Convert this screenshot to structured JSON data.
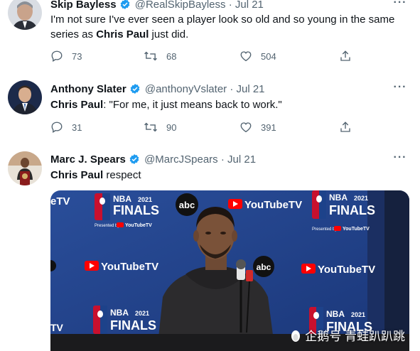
{
  "tweets": [
    {
      "name": "Skip Bayless",
      "handle": "@RealSkipBayless",
      "dot": "·",
      "date": "Jul 21",
      "text_pre": "I'm not sure I've ever seen a player look so old and so young in the same series as ",
      "text_bold": "Chris Paul",
      "text_post": " just did.",
      "replies": "73",
      "retweets": "68",
      "likes": "504"
    },
    {
      "name": "Anthony Slater",
      "handle": "@anthonyVslater",
      "dot": "·",
      "date": "Jul 21",
      "text_bold": "Chris Paul",
      "text_post": ": \"For me, it just means back to work.\"",
      "replies": "31",
      "retweets": "90",
      "likes": "391"
    },
    {
      "name": "Marc J. Spears",
      "handle": "@MarcJSpears",
      "dot": "·",
      "date": "Jul 21",
      "text_bold": "Chris Paul",
      "text_post": " respect"
    }
  ],
  "backdrop": {
    "nba": "NBA",
    "finals": "FINALS",
    "year": "2021",
    "presented_by": "Presented by",
    "youtube_tv": "YouTubeTV",
    "abc": "abc",
    "tv_partial": "eTV",
    "tv_partial_bottom": "TV"
  },
  "watermark": "企鹅号 青蛙趴趴跳",
  "colors": {
    "verified": "#1d9bf0",
    "backdrop_blue": "#1d428a",
    "nba_red": "#c8102e",
    "youtube_red": "#ff0000"
  },
  "icons": {
    "reply": "reply-icon",
    "retweet": "retweet-icon",
    "like": "heart-icon",
    "share": "share-icon",
    "more": "more-icon",
    "verified": "verified-badge-icon"
  }
}
